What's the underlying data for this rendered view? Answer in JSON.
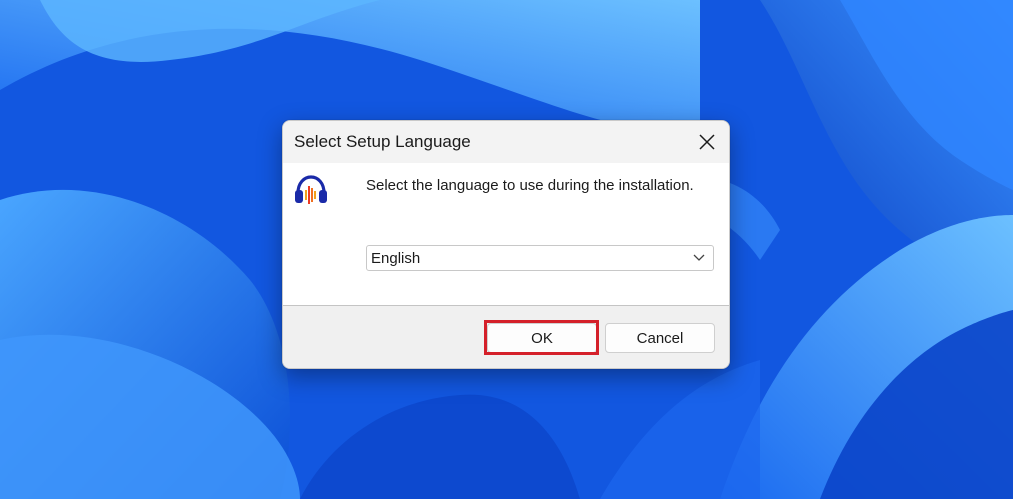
{
  "dialog": {
    "title": "Select Setup Language",
    "prompt": "Select the language to use during the installation.",
    "language_selected": "English",
    "buttons": {
      "ok": "OK",
      "cancel": "Cancel"
    },
    "app_icon": "audacity-headphones-icon",
    "close_icon": "close-icon"
  },
  "colors": {
    "wallpaper": "#1560e6",
    "highlight": "#d4202a",
    "footer": "#f0f0f0"
  }
}
